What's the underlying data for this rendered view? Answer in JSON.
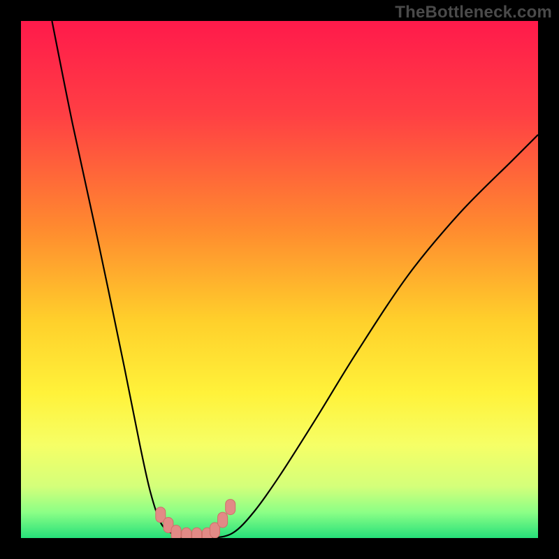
{
  "watermark": "TheBottleneck.com",
  "colors": {
    "gradient_stops": [
      {
        "offset": 0,
        "color": "#ff1a4b"
      },
      {
        "offset": 18,
        "color": "#ff3f44"
      },
      {
        "offset": 40,
        "color": "#ff8a2f"
      },
      {
        "offset": 58,
        "color": "#ffd02b"
      },
      {
        "offset": 72,
        "color": "#fff23a"
      },
      {
        "offset": 82,
        "color": "#f6ff66"
      },
      {
        "offset": 90,
        "color": "#d4ff7a"
      },
      {
        "offset": 95,
        "color": "#8cff86"
      },
      {
        "offset": 100,
        "color": "#26e07a"
      }
    ],
    "curve_stroke": "#000000",
    "marker_fill": "#e28a86",
    "marker_stroke": "#cf6f6a",
    "frame_bg": "#000000"
  },
  "chart_data": {
    "type": "line",
    "title": "",
    "xlabel": "",
    "ylabel": "",
    "xlim": [
      0,
      100
    ],
    "ylim": [
      0,
      100
    ],
    "note": "V-shaped bottleneck curve; y≈0 is optimal (green), y≈100 is worst (red). Values read from pixel positions against a 0–100 normalized grid.",
    "series": [
      {
        "name": "bottleneck-curve",
        "x": [
          6,
          10,
          15,
          20,
          23,
          25,
          27,
          29,
          30,
          31,
          34,
          37,
          41,
          45,
          50,
          57,
          65,
          75,
          85,
          95,
          100
        ],
        "y": [
          100,
          80,
          57,
          33,
          18,
          9,
          3,
          1,
          0,
          0,
          0,
          0,
          1,
          5,
          12,
          23,
          36,
          51,
          63,
          73,
          78
        ]
      }
    ],
    "markers": {
      "name": "highlight-points",
      "x": [
        27,
        28.5,
        30,
        32,
        34,
        36,
        37.5,
        39,
        40.5
      ],
      "y": [
        4.5,
        2.5,
        1,
        0.5,
        0.5,
        0.5,
        1.5,
        3.5,
        6
      ]
    }
  }
}
